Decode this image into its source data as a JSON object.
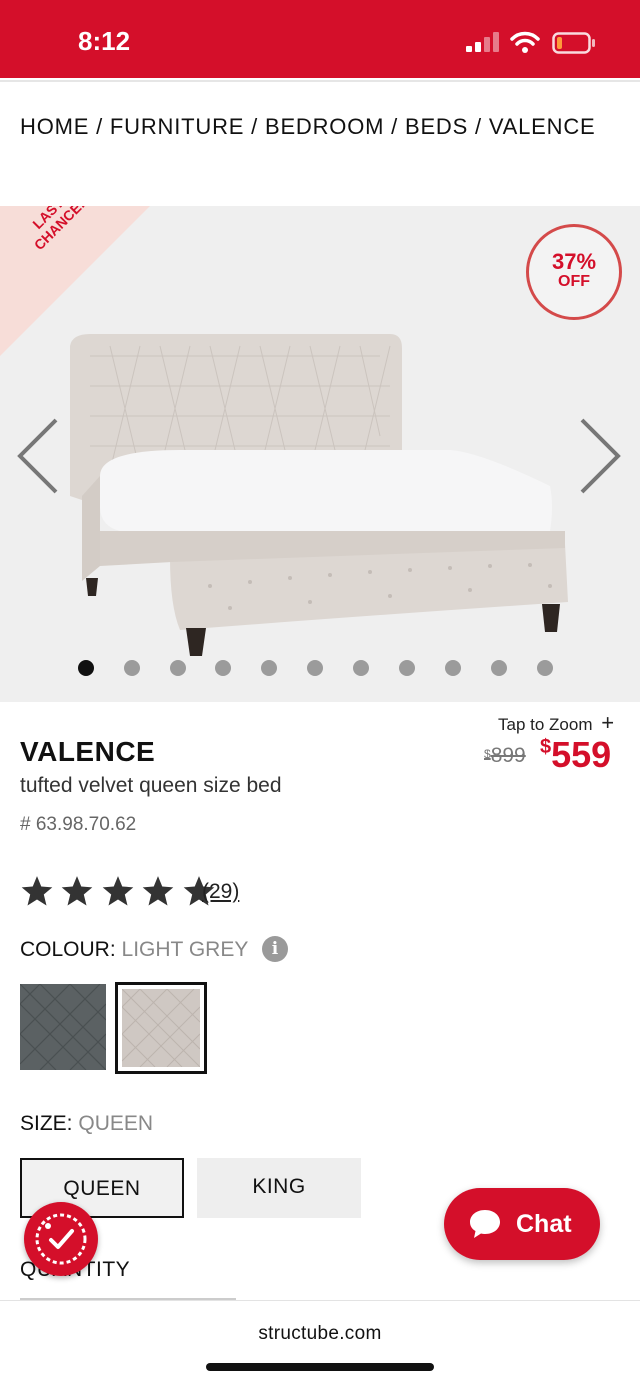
{
  "status_bar": {
    "time": "8:12",
    "background": "#d40f2a"
  },
  "breadcrumb": [
    "HOME",
    "FURNITURE",
    "BEDROOM",
    "BEDS",
    "VALENCE"
  ],
  "breadcrumb_text": "HOME / FURNITURE / BEDROOM / BEDS  / VALENCE",
  "gallery": {
    "ribbon_line1": "LAST",
    "ribbon_line2": "CHANCE!",
    "discount_pct": "37%",
    "discount_off": "OFF",
    "prev_icon": "chevron-left-icon",
    "next_icon": "chevron-right-icon",
    "image_count": 11,
    "active_image": 1
  },
  "product": {
    "tap_to_zoom": "Tap to Zoom",
    "zoom_icon": "plus-icon",
    "name": "VALENCE",
    "description": "tufted velvet queen size bed",
    "sku": "# 63.98.70.62",
    "price_currency": "$",
    "price_old": "899",
    "price_new": "559",
    "accent_color": "#d40f2a"
  },
  "rating": {
    "stars": 5,
    "review_count": "(29)"
  },
  "colour": {
    "label": "COLOUR:",
    "selected": "LIGHT GREY",
    "info_icon": "i",
    "swatches": [
      {
        "name": "dark grey",
        "color": "#5b6163"
      },
      {
        "name": "light grey",
        "color": "#cfc8c3",
        "selected": true
      }
    ]
  },
  "size": {
    "label": "SIZE:",
    "selected": "QUEEN",
    "options": [
      "QUEEN",
      "KING"
    ]
  },
  "quantity": {
    "label": "QUANTITY"
  },
  "chat": {
    "label": "Chat"
  },
  "browser": {
    "url": "structube.com"
  }
}
